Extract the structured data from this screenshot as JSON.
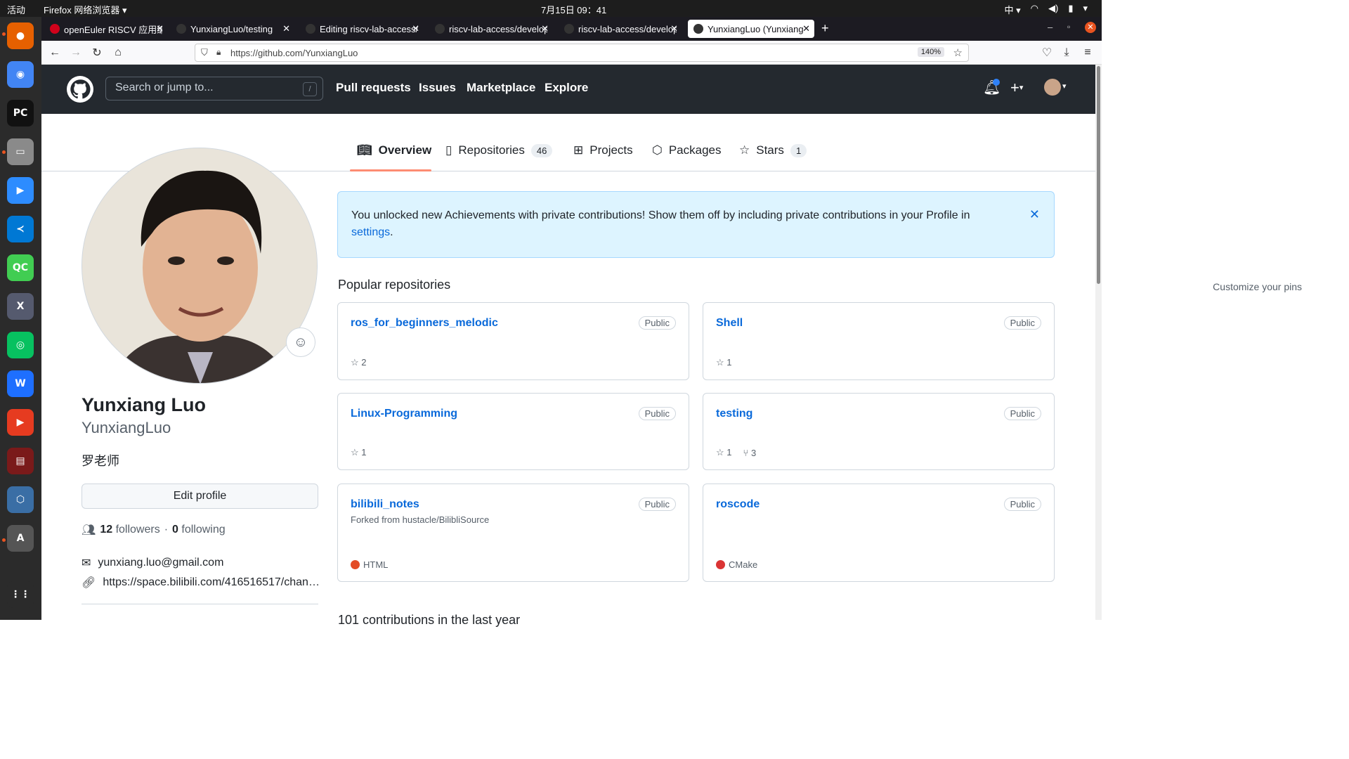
{
  "system": {
    "activities": "活动",
    "app_name": "Firefox 网络浏览器 ▾",
    "clock": "7月15日  09：41",
    "tray_input": "中 ▾"
  },
  "dock": {
    "items": [
      {
        "name": "firefox-icon",
        "glyph": "●",
        "color": "#e66000"
      },
      {
        "name": "chrome-icon",
        "glyph": "◉",
        "color": "#4285f4"
      },
      {
        "name": "pycharm-icon",
        "glyph": "PC",
        "color": "#111111"
      },
      {
        "name": "files-icon",
        "glyph": "▭",
        "color": "#8a8a8a"
      },
      {
        "name": "zoom-icon",
        "glyph": "▶",
        "color": "#2d8cff"
      },
      {
        "name": "vscode-icon",
        "glyph": "≺",
        "color": "#0078d4"
      },
      {
        "name": "qtcreator-icon",
        "glyph": "QC",
        "color": "#41cd52"
      },
      {
        "name": "xterm-icon",
        "glyph": "X",
        "color": "#555a6e"
      },
      {
        "name": "wechat-icon",
        "glyph": "◎",
        "color": "#07c160"
      },
      {
        "name": "wps-icon",
        "glyph": "W",
        "color": "#1e6fff"
      },
      {
        "name": "media-player-icon",
        "glyph": "▶",
        "color": "#e63b20"
      },
      {
        "name": "terminal-icon",
        "glyph": "▤",
        "color": "#7a1a1a"
      },
      {
        "name": "virtualbox-icon",
        "glyph": "⬡",
        "color": "#3a6ea5"
      },
      {
        "name": "software-center-icon",
        "glyph": "A",
        "color": "#555555"
      },
      {
        "name": "app-grid-icon",
        "glyph": "⋮⋮",
        "color": "#2b2b2b"
      }
    ]
  },
  "tabs": [
    {
      "label": "openEuler RISCV 应用编"
    },
    {
      "label": "YunxiangLuo/testing"
    },
    {
      "label": "Editing riscv-lab-access/d"
    },
    {
      "label": "riscv-lab-access/develop"
    },
    {
      "label": "riscv-lab-access/develop"
    },
    {
      "label": "YunxiangLuo (Yunxiang L"
    }
  ],
  "browser": {
    "url": "https://github.com/YunxiangLuo",
    "zoom": "140%"
  },
  "github": {
    "search_placeholder": "Search or jump to...",
    "slash": "/",
    "nav": [
      "Pull requests",
      "Issues",
      "Marketplace",
      "Explore"
    ],
    "profile_tabs": [
      {
        "label": "Overview"
      },
      {
        "label": "Repositories",
        "count": "46"
      },
      {
        "label": "Projects"
      },
      {
        "label": "Packages"
      },
      {
        "label": "Stars",
        "count": "1"
      }
    ]
  },
  "profile": {
    "full_name": "Yunxiang Luo",
    "login": "YunxiangLuo",
    "bio": "罗老师",
    "edit_button": "Edit profile",
    "followers_count": "12",
    "followers_label": "followers",
    "following_count": "0",
    "following_label": "following",
    "email": "yunxiang.luo@gmail.com",
    "website": "https://space.bilibili.com/416516517/chan…"
  },
  "flash": {
    "message": "You unlocked new Achievements with private contributions! Show them off by including private contributions in your Profile in",
    "link": "settings",
    "end": "."
  },
  "popular": {
    "heading": "Popular repositories",
    "customize": "Customize your pins",
    "repos": [
      {
        "name": "ros_for_beginners_melodic",
        "visibility": "Public",
        "stars": "2"
      },
      {
        "name": "Shell",
        "visibility": "Public",
        "stars": "1"
      },
      {
        "name": "Linux-Programming",
        "visibility": "Public",
        "stars": "1"
      },
      {
        "name": "testing",
        "visibility": "Public",
        "stars": "1",
        "forks": "3"
      },
      {
        "name": "bilibili_notes",
        "visibility": "Public",
        "forked_from": "Forked from hustacle/BilibliSource",
        "language": "HTML",
        "language_color": "#e34c26"
      },
      {
        "name": "roscode",
        "visibility": "Public",
        "language": "CMake",
        "language_color": "#da3434"
      }
    ]
  },
  "contributions_heading": "101 contributions in the last year"
}
